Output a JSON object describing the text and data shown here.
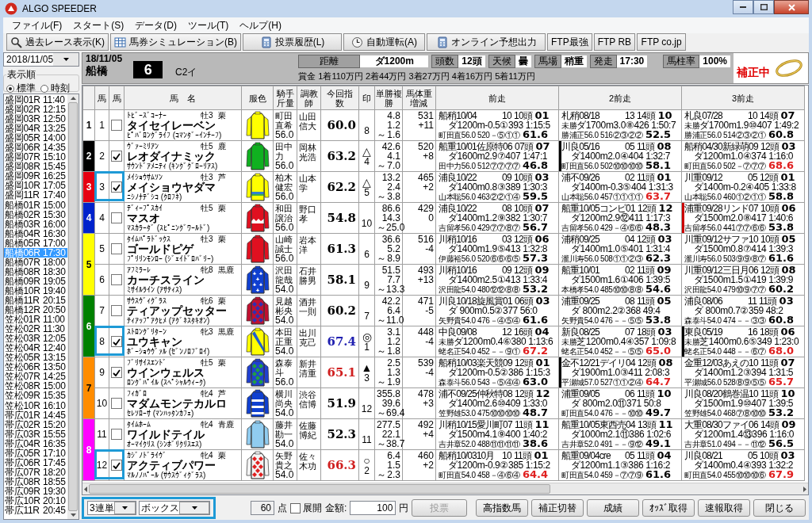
{
  "window": {
    "title": "ALGO SPEEDER"
  },
  "menu": [
    "ファイル(F)",
    "スタート(S)",
    "データ(D)",
    "ツール(T)",
    "ヘルプ(H)"
  ],
  "toolbar": [
    {
      "label": "過去レース表示(K)"
    },
    {
      "label": "馬券シミュレーション(B)"
    },
    {
      "label": "投票履歴(L)"
    },
    {
      "label": "自動運転(A)"
    },
    {
      "label": "オンライン予想出力"
    },
    {
      "label": "FTP最強"
    },
    {
      "label": "FTP RB"
    },
    {
      "label": "FTP co.jp"
    }
  ],
  "sidebar": {
    "date": "2018/11/05",
    "sort": {
      "label": "表示順",
      "options": [
        {
          "label": "標準",
          "selected": true
        },
        {
          "label": "時刻",
          "selected": false
        }
      ]
    },
    "races": [
      {
        "label": "盛岡01R",
        "time": "11:40",
        "selected": false
      },
      {
        "label": "盛岡02R",
        "time": "12:15",
        "selected": false
      },
      {
        "label": "盛岡03R",
        "time": "12:50",
        "selected": false
      },
      {
        "label": "盛岡04R",
        "time": "13:25",
        "selected": false
      },
      {
        "label": "盛岡05R",
        "time": "14:00",
        "selected": false
      },
      {
        "label": "盛岡06R",
        "time": "14:35",
        "selected": false
      },
      {
        "label": "盛岡07R",
        "time": "15:10",
        "selected": false
      },
      {
        "label": "盛岡08R",
        "time": "15:45",
        "selected": false
      },
      {
        "label": "盛岡09R",
        "time": "16:25",
        "selected": false
      },
      {
        "label": "盛岡10R",
        "time": "17:05",
        "selected": false
      },
      {
        "label": "盛岡11R",
        "time": "17:40",
        "selected": false
      },
      {
        "label": "船橋01R",
        "time": "15:00",
        "selected": false
      },
      {
        "label": "船橋02R",
        "time": "15:30",
        "selected": false
      },
      {
        "label": "船橋03R",
        "time": "16:00",
        "selected": false
      },
      {
        "label": "船橋04R",
        "time": "16:30",
        "selected": false
      },
      {
        "label": "船橋05R",
        "time": "17:00",
        "selected": false
      },
      {
        "label": "船橋06R",
        "time": "17:30",
        "selected": true
      },
      {
        "label": "船橋07R",
        "time": "18:00",
        "selected": false
      },
      {
        "label": "船橋08R",
        "time": "18:30",
        "selected": false
      },
      {
        "label": "船橋09R",
        "time": "19:05",
        "selected": false
      },
      {
        "label": "船橋10R",
        "time": "19:40",
        "selected": false
      },
      {
        "label": "船橋11R",
        "time": "20:15",
        "selected": false
      },
      {
        "label": "船橋12R",
        "time": "20:50",
        "selected": false
      },
      {
        "label": "笠松01R",
        "time": "11:00",
        "selected": false
      },
      {
        "label": "笠松02R",
        "time": "11:30",
        "selected": false
      },
      {
        "label": "笠松03R",
        "time": "12:05",
        "selected": false
      },
      {
        "label": "笠松04R",
        "time": "12:40",
        "selected": false
      },
      {
        "label": "笠松05R",
        "time": "13:15",
        "selected": false
      },
      {
        "label": "笠松06R",
        "time": "13:50",
        "selected": false
      },
      {
        "label": "笠松07R",
        "time": "14:25",
        "selected": false
      },
      {
        "label": "笠松08R",
        "time": "15:00",
        "selected": false
      },
      {
        "label": "笠松09R",
        "time": "15:35",
        "selected": false
      },
      {
        "label": "笠松10R",
        "time": "16:10",
        "selected": false
      },
      {
        "label": "帯広01R",
        "time": "14:45",
        "selected": false
      },
      {
        "label": "帯広02R",
        "time": "15:20",
        "selected": false
      },
      {
        "label": "帯広03R",
        "time": "15:55",
        "selected": false
      },
      {
        "label": "帯広04R",
        "time": "16:35",
        "selected": false
      },
      {
        "label": "帯広05R",
        "time": "17:10",
        "selected": false
      },
      {
        "label": "帯広06R",
        "time": "17:45",
        "selected": false
      },
      {
        "label": "帯広07R",
        "time": "18:20",
        "selected": false
      },
      {
        "label": "帯広08R",
        "time": "18:55",
        "selected": false
      },
      {
        "label": "帯広09R",
        "time": "19:30",
        "selected": false
      },
      {
        "label": "帯広10R",
        "time": "20:10",
        "selected": false
      },
      {
        "label": "帯広11R",
        "time": "20:45",
        "selected": false
      }
    ]
  },
  "race": {
    "date": "18/11/05",
    "venue": "船橋",
    "number": "6",
    "class": "C2イ",
    "info": [
      {
        "label": "距離",
        "value": "ダ1200m"
      },
      {
        "label": "頭数",
        "value": "12頭"
      },
      {
        "label": "天候",
        "value": "曇"
      },
      {
        "label": "馬場",
        "value": "稍重"
      },
      {
        "label": "発走",
        "value": "17:30"
      },
      {
        "label": "馬柱率",
        "value": "100%"
      }
    ],
    "prize": "賞金 1着110万円 2着44万円 3着27万円 4着16万円 5着11万円",
    "status": "補正中"
  },
  "table": {
    "columns": [
      "馬",
      "馬",
      "馬　名",
      "服色",
      "騎手斤量",
      "調教師",
      "今回指数",
      "印",
      "単勝複勝",
      "馬体重増減",
      "前走",
      "2前走",
      "3前走"
    ],
    "frames": [
      {
        "number": "1",
        "color": "#ffffff",
        "horses": [
          {
            "number": "1",
            "checked": false,
            "highlighted": false,
            "sire": "ﾄﾋﾞｰｽﾞｺｰﾅｰ",
            "sex_age": "牡3",
            "coat": "栗",
            "name": "タイセイレーベン",
            "dam": "ﾋﾟﾊﾞﾛﾝｸﾞﾗｲﾌ (ｺﾏﾝﾀﾞｰｲﾝﾁｰﾌ)",
            "silk": {
              "kind": "plain",
              "color": "#ffff00"
            },
            "jockey": "町田直希",
            "carried": "56.0",
            "trainer": "山田信大",
            "index": {
              "value": "60.0",
              "color": "#000000"
            },
            "popularity": "8",
            "win": "4.8",
            "place_low": "1.2",
            "tilde": "～",
            "place_high": "1.6",
            "body_weight": "531",
            "weight_change": "+11",
            "past": [
              {
                "race": "船稍10/04",
                "field": "10 10頭",
                "finish": "01",
                "course": "ダ1200m-0.5①393 1:15:5",
                "result": "町田直56.0 520－⑤①①",
                "score": "61.6",
                "high": false
              },
              {
                "race": "札稍08/18",
                "field": "13 14頭",
                "finish": "10",
                "class": "未勝",
                "course": "ダ1700m3.0⑧426 1:50:7",
                "result": "勝浦正56.0 516②③②②",
                "score": "52.5",
                "high": false
              },
              {
                "race": "札良07/28",
                "field": "10 14頭",
                "finish": "07",
                "class": "未勝",
                "course": "ダ1700m1.9⑩407 1:49:2",
                "result": "勝浦正56.0 514②③②①",
                "score": "60.8",
                "high": false
              }
            ]
          }
        ]
      },
      {
        "number": "2",
        "color": "#000000",
        "horses": [
          {
            "number": "2",
            "checked": true,
            "highlighted": false,
            "sire": "ｳﾞｧｰﾐﾘｱﾝ",
            "sex_age": "牡5",
            "coat": "鹿",
            "name": "レオダイナミック",
            "dam": "ｻｳﾝﾄﾞｱﾒﾆﾃｨ (ｷﾝｸﾞｸﾞﾛｰﾘｱｽ)",
            "silk": {
              "kind": "plain",
              "color": "#10b020"
            },
            "jockey": "田中力",
            "carried": "56.0",
            "trainer": "岡林光浩",
            "index": {
              "value": "63.2",
              "color": "#000000"
            },
            "mark": "△",
            "popularity": "4",
            "win": "42.6",
            "place_low": "4.1",
            "tilde": "～",
            "place_high": "7.0",
            "body_weight": "520",
            "weight_change": "+8",
            "past": [
              {
                "race": "船重10/01佐原特",
                "field": "06 07頭",
                "finish": "07",
                "course": "ダ1600m2.9⑦407 1:47:1",
                "result": "田中力56.0 512⑦⑦⑦⑦",
                "score": "46.8",
                "high": false
              },
              {
                "race": "川良05/16",
                "field": "05 11頭",
                "finish": "08",
                "course": "ダ1400m2.0④404 1:32:7",
                "result": "町田直56.0 502⑩⑩⑩⑩",
                "score": "58.1",
                "high": false,
                "color": "#000000"
              },
              {
                "race": "船稍04/30新緑萌",
                "field": "09 12頭",
                "finish": "03",
                "course": "ダ1200m1.0④374 1:16:0",
                "result": "町田直56.0 502－⑦⑦⑦",
                "score": "68.6",
                "high": true
              }
            ]
          }
        ]
      },
      {
        "number": "3",
        "color": "#e60012",
        "horses": [
          {
            "number": "3",
            "checked": true,
            "highlighted": true,
            "sire": "ﾒｲｼｮｳｻﾑｿﾝ",
            "sex_age": "牡3",
            "coat": "芦",
            "name": "メイショウヤダマ",
            "dam": "ﾆｼﾉﾅﾃﾞｼｺ (ｸﾛﾌﾈ)",
            "silk": {
              "kind": "hoop",
              "color": "#ffff00"
            },
            "jockey": "柏木健宏",
            "carried": "56.0",
            "trainer": "山本学",
            "index": {
              "value": "62.2",
              "color": "#000000"
            },
            "mark": "△",
            "popularity": "5",
            "win": "13.2",
            "place_low": "2.4",
            "tilde": "～",
            "place_high": "3.8",
            "body_weight": "465",
            "weight_change": "+2",
            "past": [
              {
                "race": "浦良10/22",
                "field": "09 10頭",
                "finish": "03",
                "course": "ダ1400m0.8③389 1:30:3",
                "result": "山本聡56.0 463②②①④",
                "score": "59.5",
                "high": false
              },
              {
                "race": "浦不09/26",
                "field": "02 11頭",
                "finish": "01",
                "course": "ダ1400m-0.3⑤404 1:31:3",
                "result": "山本聡56.0 457①①①①",
                "score": "63.7",
                "high": true
              },
              {
                "race": "川重09/12",
                "field": "05 12頭",
                "finish": "01",
                "course": "ダ1400m-0.2④405 1:33:8",
                "result": "山本聡56.0 460①②①①",
                "score": "58.8",
                "high": false
              }
            ]
          }
        ]
      },
      {
        "number": "4",
        "color": "#0022cc",
        "horses": [
          {
            "number": "4",
            "checked": false,
            "highlighted": false,
            "sire": "ﾃﾞｨｰﾌﾟｽｶｲ",
            "sex_age": "牡5",
            "coat": "栗",
            "name": "マスオ",
            "dam": "ﾏｽｶﾗｰﾀﾞ (ｽﾋﾟﾆﾝｸﾞﾜｰﾙﾄﾞ)",
            "silk": {
              "kind": "zigzag",
              "color": "#e01020"
            },
            "jockey": "和田譲治",
            "carried": "56.0",
            "trainer": "野口孝",
            "index": {
              "value": "54.8",
              "color": "#000000"
            },
            "popularity": "10",
            "win": "86.6",
            "place_low": "14.3",
            "tilde": "～",
            "place_high": "25.0",
            "body_weight": "429",
            "weight_change": "0",
            "past": [
              {
                "race": "浦良10/22",
                "field": "08 10頭",
                "finish": "07",
                "course": "ダ1400m1.2⑨382 1:30:7",
                "result": "吉留孝56.0 429⑦⑦⑧⑦",
                "score": "56.7",
                "high": false
              },
              {
                "race": "船重10/05コンビ",
                "field": "01 12頭",
                "finish": "12",
                "course": "ダ1200m2.9⑫411 1:17:3",
                "result": "吉留孝56.0 429－④⑥⑥",
                "score": "48.3",
                "high": false
              },
              {
                "race": "浦重09/28リンド",
                "field": "07 10頭",
                "finish": "06",
                "course": "ダ1500m2.0⑧417 1:40:6",
                "result": "吉留孝56.0 441⑦⑦⑥⑥",
                "score": "53.8",
                "high": false,
                "color": "#cc0000"
              }
            ]
          }
        ]
      },
      {
        "number": "5",
        "color": "#ffff00",
        "horses": [
          {
            "number": "5",
            "checked": false,
            "highlighted": false,
            "sire": "ﾀｲﾑﾊﾟﾗﾄﾞｯｸｽ",
            "sex_age": "牡3",
            "coat": "栗",
            "name": "ゴールドピゲ",
            "dam": "ﾌﾟﾘﾘﾝﾓﾝﾛｰ (ｼﾞｪｲﾄﾞﾛﾊﾞﾘｰ)",
            "silk": {
              "kind": "plain",
              "color": "#e01020"
            },
            "jockey": "山崎誠士",
            "carried": "56.0",
            "trainer": "岩本洋",
            "index": {
              "value": "61.3",
              "color": "#000000"
            },
            "popularity": "6",
            "win": "36.6",
            "place_low": "5.2",
            "tilde": "～",
            "place_high": "8.9",
            "body_weight": "516",
            "weight_change": "-4",
            "past": [
              {
                "race": "川稍10/16",
                "field": "03 12頭",
                "finish": "06",
                "course": "ダ1400m1.9⑤413 1:32:8",
                "result": "伊藤裕56.0 520⑥⑥⑥⑤",
                "score": "57.3",
                "high": false
              },
              {
                "race": "浦稍09/25",
                "field": "04 12頭",
                "finish": "03",
                "course": "ダ1400m1.0⑤401 1:31:4",
                "result": "瀧川寿56.0 508①①②③",
                "score": "62.3",
                "high": false
              },
              {
                "race": "川重09/12サファ",
                "field": "10 10頭",
                "finish": "05",
                "course": "ダ1500m0.8⑦414 1:39:3",
                "result": "瀧川寿56.0 503⑨⑨⑧⑦",
                "score": "61.6",
                "high": false
              }
            ]
          },
          {
            "number": "6",
            "checked": false,
            "highlighted": false,
            "sire": "ｱﾌﾐﾗｰﾚ",
            "sex_age": "牝8",
            "coat": "黒鹿",
            "name": "カーチスライン",
            "dam": "ﾐｻｲﾙﾗｲﾝ (ｱｻﾃｨｽ)",
            "silk": {
              "kind": "stars",
              "color": "#1040d0"
            },
            "jockey": "沢田龍哉",
            "carried": "54.0",
            "trainer": "石井勝男",
            "index": {
              "value": "58.1",
              "color": "#000000"
            },
            "popularity": "9",
            "win": "51.5",
            "place_low": "7.7",
            "tilde": "～",
            "place_high": "13.3",
            "body_weight": "493",
            "weight_change": "+13",
            "past": [
              {
                "race": "川稍10/16",
                "field": "09 12頭",
                "finish": "09",
                "course": "ダ1400m2.5①413 1:33:4",
                "result": "沢田龍54.0 480⑫⑫⑧⑧",
                "score": "53.2",
                "high": false
              },
              {
                "race": "船重10/01",
                "field": "02 11頭",
                "finish": "09",
                "course": "ダ1500m1.6①406 1:39:5",
                "result": "本橋孝54.0 485⑩⑩⑧⑧",
                "score": "54.6",
                "high": false
              },
              {
                "race": "川重09/12三日月",
                "field": "06 12頭",
                "finish": "08",
                "course": "ダ1500m1.5①419 1:39:9",
                "result": "沢田龍54.0 479⑩⑨⑦⑦",
                "score": "60.2",
                "high": false
              }
            ]
          }
        ]
      },
      {
        "number": "6",
        "color": "#008000",
        "horses": [
          {
            "number": "7",
            "checked": false,
            "highlighted": false,
            "sire": "ｻｳｽｳﾞｨｸﾞﾗｽ",
            "sex_age": "牝6",
            "coat": "栗",
            "name": "ティアップセッター",
            "dam": "ﾃｨｱｯﾌﾟｱｸﾋﾒ (ｱｸﾞﾈｽﾀｷｵﾝ)",
            "silk": {
              "kind": "diamonds",
              "color": "#c01030"
            },
            "jockey": "見越彬央",
            "carried": "54.0",
            "trainer": "酒井一則",
            "index": {
              "value": "60.2",
              "color": "#000000"
            },
            "popularity": "7",
            "win": "42.2",
            "place_low": "6.4",
            "tilde": "～",
            "place_high": "11.0",
            "body_weight": "471",
            "weight_change": "-5",
            "past": [
              {
                "race": "川良10/18旋風賞",
                "field": "01 06頭",
                "finish": "03",
                "course": "ダ 900m0.5②377 56:0",
                "result": "矢野貴54.0 476－④⑤④",
                "score": "61.6",
                "high": false
              },
              {
                "race": "浦重09/25",
                "field": "08 11頭",
                "finish": "05",
                "course": "ダ 800m2.2②368 49:4",
                "result": "矢野貴54.0 476－－⑤⑤",
                "score": "53.8",
                "high": false
              },
              {
                "race": "浦良08/06",
                "field": "11 11頭",
                "finish": "03",
                "course": "ダ 800m0.7②359 48:2",
                "result": "森泰斗54.0 474－－③③",
                "score": "60.8",
                "high": false
              }
            ]
          },
          {
            "number": "8",
            "checked": true,
            "highlighted": true,
            "sire": "ｽﾄﾛﾝｸﾞﾘﾀｰﾝ",
            "sex_age": "牝3",
            "coat": "黒鹿",
            "name": "ユウキャン",
            "dam": "ﾎﾞｰｼｮｳｳﾞｧﾙ (ｾﾞﾝﾉﾛﾌﾞﾛｲ)",
            "silk": {
              "kind": "sash",
              "color": "#ffff00"
            },
            "jockey": "本田正重",
            "carried": "54.0",
            "trainer": "出川克己",
            "index": {
              "value": "67.4",
              "color": "#2020b0"
            },
            "mark": "◎",
            "popularity": "1",
            "win": "3.1",
            "place_low": "1.2",
            "tilde": "～",
            "place_high": "1.8",
            "body_weight": "448",
            "weight_change": "-4",
            "past": [
              {
                "race": "中良09/08",
                "field": "12 16頭",
                "finish": "04",
                "class": "未勝",
                "course": "ダ1200m0.4⑥380 1:13:6",
                "result": "蛯名正54.0 452－－⑨①",
                "score": "67.2",
                "high": true
              },
              {
                "race": "新良08/25",
                "field": "07 18頭",
                "finish": "03",
                "class": "未勝",
                "course": "芝1200m0.4④357 1:09:8",
                "result": "蛯名正54.0 452－－⑤⑤",
                "score": "65.0",
                "high": true
              },
              {
                "race": "東良05/19",
                "field": "16 18頭",
                "finish": "06",
                "class": "未勝",
                "course": "芝1400m0.6⑤349 1:23:0",
                "result": "蛯名正54.0 448－－⑥⑦",
                "score": "68.0",
                "high": true,
                "color": "#000000"
              }
            ]
          }
        ]
      },
      {
        "number": "7",
        "color": "#ff8c00",
        "horses": [
          {
            "number": "9",
            "checked": true,
            "highlighted": false,
            "sire": "ﾌﾞﾘｻｲｽｴﾝﾄﾞ",
            "sex_age": "牡5",
            "coat": "栗",
            "name": "ウインウェルス",
            "dam": "ﾛﾝｸﾞﾊﾟｲﾙ (ｽﾍﾟｼｬﾙｳｨｰｸ)",
            "silk": {
              "kind": "diamonds",
              "color": "#2040d0"
            },
            "jockey": "森泰斗",
            "carried": "56.0",
            "trainer": "新井清重",
            "index": {
              "value": "65.1",
              "color": "#d02020"
            },
            "mark": "▲",
            "popularity": "3",
            "win": "2.5",
            "place_low": "1.3",
            "tilde": "～",
            "place_high": "1.9",
            "body_weight": "539",
            "weight_change": "-4",
            "past": [
              {
                "race": "船稍10/03楽天競",
                "field": "09 12頭",
                "finish": "01",
                "course": "ダ1200m-0.5②386 1:15:3",
                "result": "森泰斗56.0 543－⑤④④",
                "score": "63.0",
                "high": false
              },
              {
                "race": "金不12/21デイリ",
                "field": "04 12頭",
                "finish": "08",
                "course": "ダ1900m1.0③411 2:08:3",
                "result": "平瀬城57.0 527①①②④",
                "score": "64.7",
                "high": true,
                "color": "#000000"
              },
              {
                "race": "金重12/03あえの",
                "field": "10 11頭",
                "finish": "07",
                "course": "ダ1400m1.2③394 1:31:5",
                "result": "平瀬城56.0 528⑧⑨⑤⑤",
                "score": "65.7",
                "high": true
              }
            ]
          },
          {
            "number": "10",
            "checked": false,
            "highlighted": false,
            "sire": "ﾌｨｶﾞﾛ",
            "sex_age": "牝4",
            "coat": "芦",
            "name": "マダムモンテカルロ",
            "dam": "ｾﾚｿﾛｰｻ (ﾏﾝﾊｯﾀﾝｶﾌｪ)",
            "silk": {
              "kind": "hoops",
              "color": "#1040d0"
            },
            "jockey": "横川尚央",
            "carried": "54.0",
            "trainer": "渋谷信博",
            "index": {
              "value": "51.9",
              "color": "#000000"
            },
            "popularity": "12",
            "win": "355.8",
            "place_low": "39.6",
            "tilde": "～",
            "place_high": "69.4",
            "body_weight": "478",
            "weight_change": "+3",
            "past": [
              {
                "race": "浦不09/25仲秋特",
                "field": "08 12頭",
                "finish": "12",
                "course": "ダ1400m2.6⑩409 1:33:0",
                "result": "笠野雄53.0 475⑩⑩⑩⑩",
                "score": "48.7",
                "high": false
              },
              {
                "race": "浦重09/05",
                "field": "06 11頭",
                "finish": "10",
                "course": "ダ 800m2.0⑪371 50:8",
                "result": "町田直54.0 476－－⑩⑩",
                "score": "49.7",
                "high": false
              },
              {
                "race": "川良08/20鶴巻温",
                "field": "10 11頭",
                "finish": "10",
                "course": "ダ1500m1.9⑩407 1:39:5",
                "result": "笠野雄54.0 468⑦⑧⑩⑩",
                "score": "53.2",
                "high": false
              }
            ]
          }
        ]
      },
      {
        "number": "8",
        "color": "#ff00ff",
        "horses": [
          {
            "number": "11",
            "checked": false,
            "highlighted": false,
            "sire": "ﾀｲﾑﾎｰﾑ",
            "sex_age": "牝4",
            "coat": "青鹿",
            "name": "ワイルドテイル",
            "dam": "ｵｰﾏｲｸﾘｽ (ｼﾝﾎﾞﾘｸﾘｽｴｽ)",
            "silk": {
              "kind": "plain",
              "color": "#90ccf0"
            },
            "jockey": "藤井勘一",
            "carried": "54.0",
            "trainer": "佐藤博紀",
            "index": {
              "value": "52.3",
              "color": "#000000"
            },
            "popularity": "11",
            "win": "277.5",
            "place_low": "22.1",
            "tilde": "～",
            "place_high": "38.7",
            "body_weight": "492",
            "weight_change": "+4",
            "past": [
              {
                "race": "川稍10/15愛川町",
                "field": "07 11頭",
                "finish": "11",
                "course": "ダ1500m4.1⑨400 1:40:2",
                "result": "吉井章52.0 488⑪⑪⑪⑪",
                "score": "38.6",
                "high": false
              },
              {
                "race": "船重10/05東西売",
                "field": "04 13頭",
                "finish": "11",
                "course": "ダ1000m2.1⑪386 1:02:6",
                "result": "吉井章52.0 491－－⑨⑫",
                "score": "49.1",
                "high": false
              },
              {
                "race": "大重08/30ファイ",
                "field": "06 14頭",
                "finish": "09",
                "course": "ダ1200m1.4⑬396 1:16:0",
                "result": "吉井章51.0 494－－⑪⑫",
                "score": "56.5",
                "high": false
              }
            ]
          },
          {
            "number": "12",
            "checked": true,
            "highlighted": true,
            "sire": "ｶｼﾞﾉﾄﾞﾗｲｳﾞ",
            "sex_age": "牝4",
            "coat": "栗",
            "name": "アクティブパワー",
            "dam": "ﾏﾙﾉﾉﾊﾟｰﾙ (ｻｳｽｳﾞｨｸﾞﾗｽ)",
            "silk": {
              "kind": "diamonds",
              "color": "#f4f4f4"
            },
            "jockey": "矢野貴之",
            "carried": "54.0",
            "trainer": "佐々木功",
            "index": {
              "value": "66.3",
              "color": "#d02020"
            },
            "mark": "○",
            "popularity": "2",
            "win": "6.4",
            "place_low": "1.5",
            "tilde": "～",
            "place_high": "2.3",
            "body_weight": "460",
            "weight_change": "+2",
            "past": [
              {
                "race": "船稍10/0310月",
                "field": "10 11頭",
                "finish": "01",
                "course": "ダ1200m-0.9②385 1:15:2",
                "result": "町田直54.0 458－④⑥④",
                "score": "64.4",
                "high": true
              },
              {
                "race": "船重09/04cre",
                "field": "05 11頭",
                "finish": "04",
                "course": "ダ1200m1.1③386 1:16:2",
                "result": "町田直54.0 459－⑦⑦⑨",
                "score": "61.6",
                "high": false
              },
              {
                "race": "川良08/21",
                "field": "05 10頭",
                "finish": "03",
                "course": "ダ1400m0.4④393 1:32:2",
                "result": "町田直54.0 455⑩⑩⑩⑥",
                "score": "67.9",
                "high": true
              }
            ]
          }
        ]
      }
    ]
  },
  "bottom": {
    "bet_type": "3連単",
    "bet_method": "ボックス",
    "highlighted": true,
    "points": "60",
    "points_unit": "点",
    "expand": {
      "label": "展開",
      "checked": false
    },
    "amount_label": "金額:",
    "amount": "100",
    "amount_unit": "円",
    "vote": {
      "label": "投票",
      "disabled": true
    },
    "buttons": [
      "高指数馬",
      "補正切替",
      "成績",
      "ｵｯｽﾞ取得",
      "速報取得",
      "閉じる"
    ]
  }
}
